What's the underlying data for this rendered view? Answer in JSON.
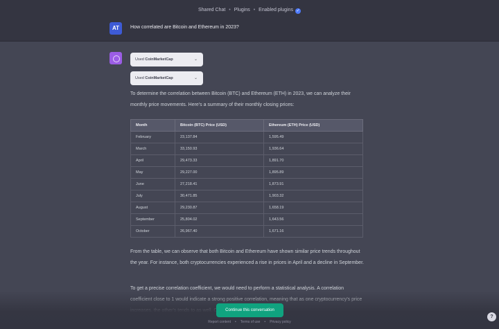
{
  "header": {
    "breadcrumb": [
      "Shared Chat",
      "Plugins",
      "Enabled plugins"
    ],
    "separator": "•"
  },
  "user_message": {
    "avatar_initials": "AT",
    "text": "How correlated are Bitcoin and Ethereum in 2023?"
  },
  "plugins": [
    {
      "prefix": "Used ",
      "name": "CoinMarketCap"
    },
    {
      "prefix": "Used ",
      "name": "CoinMarketCap"
    }
  ],
  "assistant": {
    "intro": "To determine the correlation between Bitcoin (BTC) and Ethereum (ETH) in 2023, we can analyze their monthly price movements. Here's a summary of their monthly closing prices:",
    "table": {
      "headers": [
        "Month",
        "Bitcoin (BTC) Price (USD)",
        "Ethereum (ETH) Price (USD)"
      ],
      "rows": [
        [
          "February",
          "23,137.84",
          "1,595.49"
        ],
        [
          "March",
          "33,150.93",
          "1,936.64"
        ],
        [
          "April",
          "29,473.33",
          "1,891.70"
        ],
        [
          "May",
          "29,227.00",
          "1,895.89"
        ],
        [
          "June",
          "27,218.41",
          "1,873.91"
        ],
        [
          "July",
          "30,471.85",
          "1,903.32"
        ],
        [
          "August",
          "29,230.87",
          "1,658.19"
        ],
        [
          "September",
          "25,804.02",
          "1,643.56"
        ],
        [
          "October",
          "26,967.40",
          "1,671.16"
        ]
      ]
    },
    "para2": "From the table, we can observe that both Bitcoin and Ethereum have shown similar price trends throughout the year. For instance, both cryptocurrencies experienced a rise in prices in April and a decline in September.",
    "para3": "To get a precise correlation coefficient, we would need to perform a statistical analysis. A correlation coefficient close to 1 would indicate a strong positive correlation, meaning that as one cryptocurrency's price increases, the other's tends to as well. Conversely, a coefficient close"
  },
  "continue_button": "Continue this conversation",
  "footer": [
    "Report content",
    "Terms of use",
    "Privacy policy"
  ],
  "help_label": "?",
  "colors": {
    "background": "#444654",
    "header_bg": "#343541",
    "accent_green": "#10a37f",
    "assistant_avatar": "#9b5de5",
    "user_avatar": "#3e5bd6"
  }
}
